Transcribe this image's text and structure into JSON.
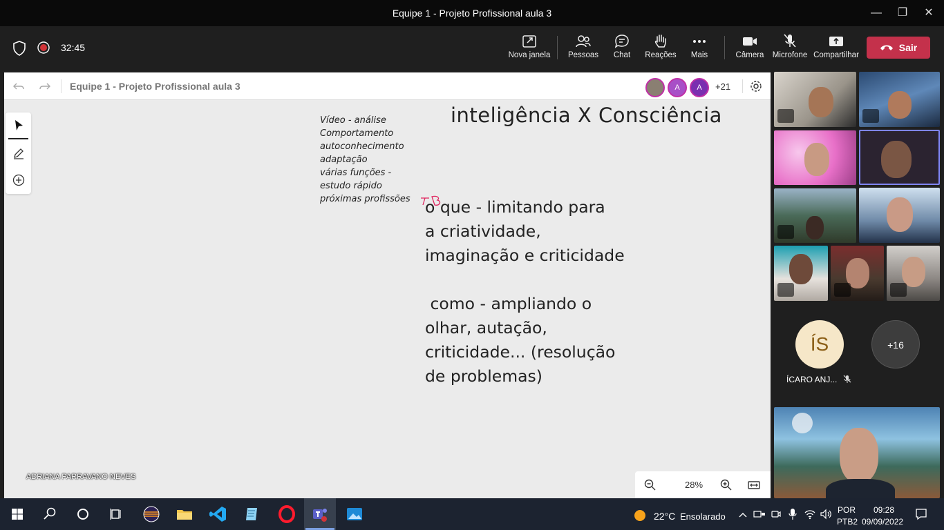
{
  "window": {
    "title": "Equipe 1 - Projeto Profissional aula 3",
    "minimize": "—",
    "maximize": "❐",
    "close": "✕"
  },
  "meeting": {
    "timer": "32:45",
    "tools": [
      {
        "label": "Nova janela",
        "icon": "new-window-icon"
      },
      {
        "label": "Pessoas",
        "icon": "people-icon"
      },
      {
        "label": "Chat",
        "icon": "chat-icon"
      },
      {
        "label": "Reações",
        "icon": "raise-hand-icon"
      },
      {
        "label": "Mais",
        "icon": "more-icon"
      },
      {
        "label": "Câmera",
        "icon": "camera-icon"
      },
      {
        "label": "Microfone",
        "icon": "mic-muted-icon"
      },
      {
        "label": "Compartilhar",
        "icon": "share-icon"
      }
    ],
    "leave_label": "Sair",
    "leave_color": "#c4314b"
  },
  "whiteboard": {
    "name": "Equipe 1 - Projeto Profissional aula 3",
    "avatars": [
      "A",
      "A"
    ],
    "avatar_more": "+21",
    "notes": [
      "Vídeo - análise",
      "Comportamento",
      "autoconhecimento",
      "adaptação",
      "várias funções -",
      "estudo rápido",
      "próximas profissões"
    ],
    "title": "inteligência X Consciência",
    "block1": [
      "o que  -  limitando para",
      "a criatividade,",
      "imaginação e criticidade"
    ],
    "block2": [
      " como - ampliando o",
      "olhar, autação,",
      "criticidade... (resolução",
      "de problemas)"
    ],
    "presenter": "ADRIANA PARRAVANO NEVES",
    "zoom": "28%",
    "pen_color": "#e0245e"
  },
  "participants": {
    "icaro_initials": "ÍS",
    "icaro_name": "ÍCARO ANJ...",
    "more_count": "+16"
  },
  "taskbar": {
    "weather_temp": "22°C",
    "weather_desc": "Ensolarado",
    "lang": "POR",
    "layout": "PTB2",
    "time": "09:28",
    "date": "09/09/2022"
  }
}
